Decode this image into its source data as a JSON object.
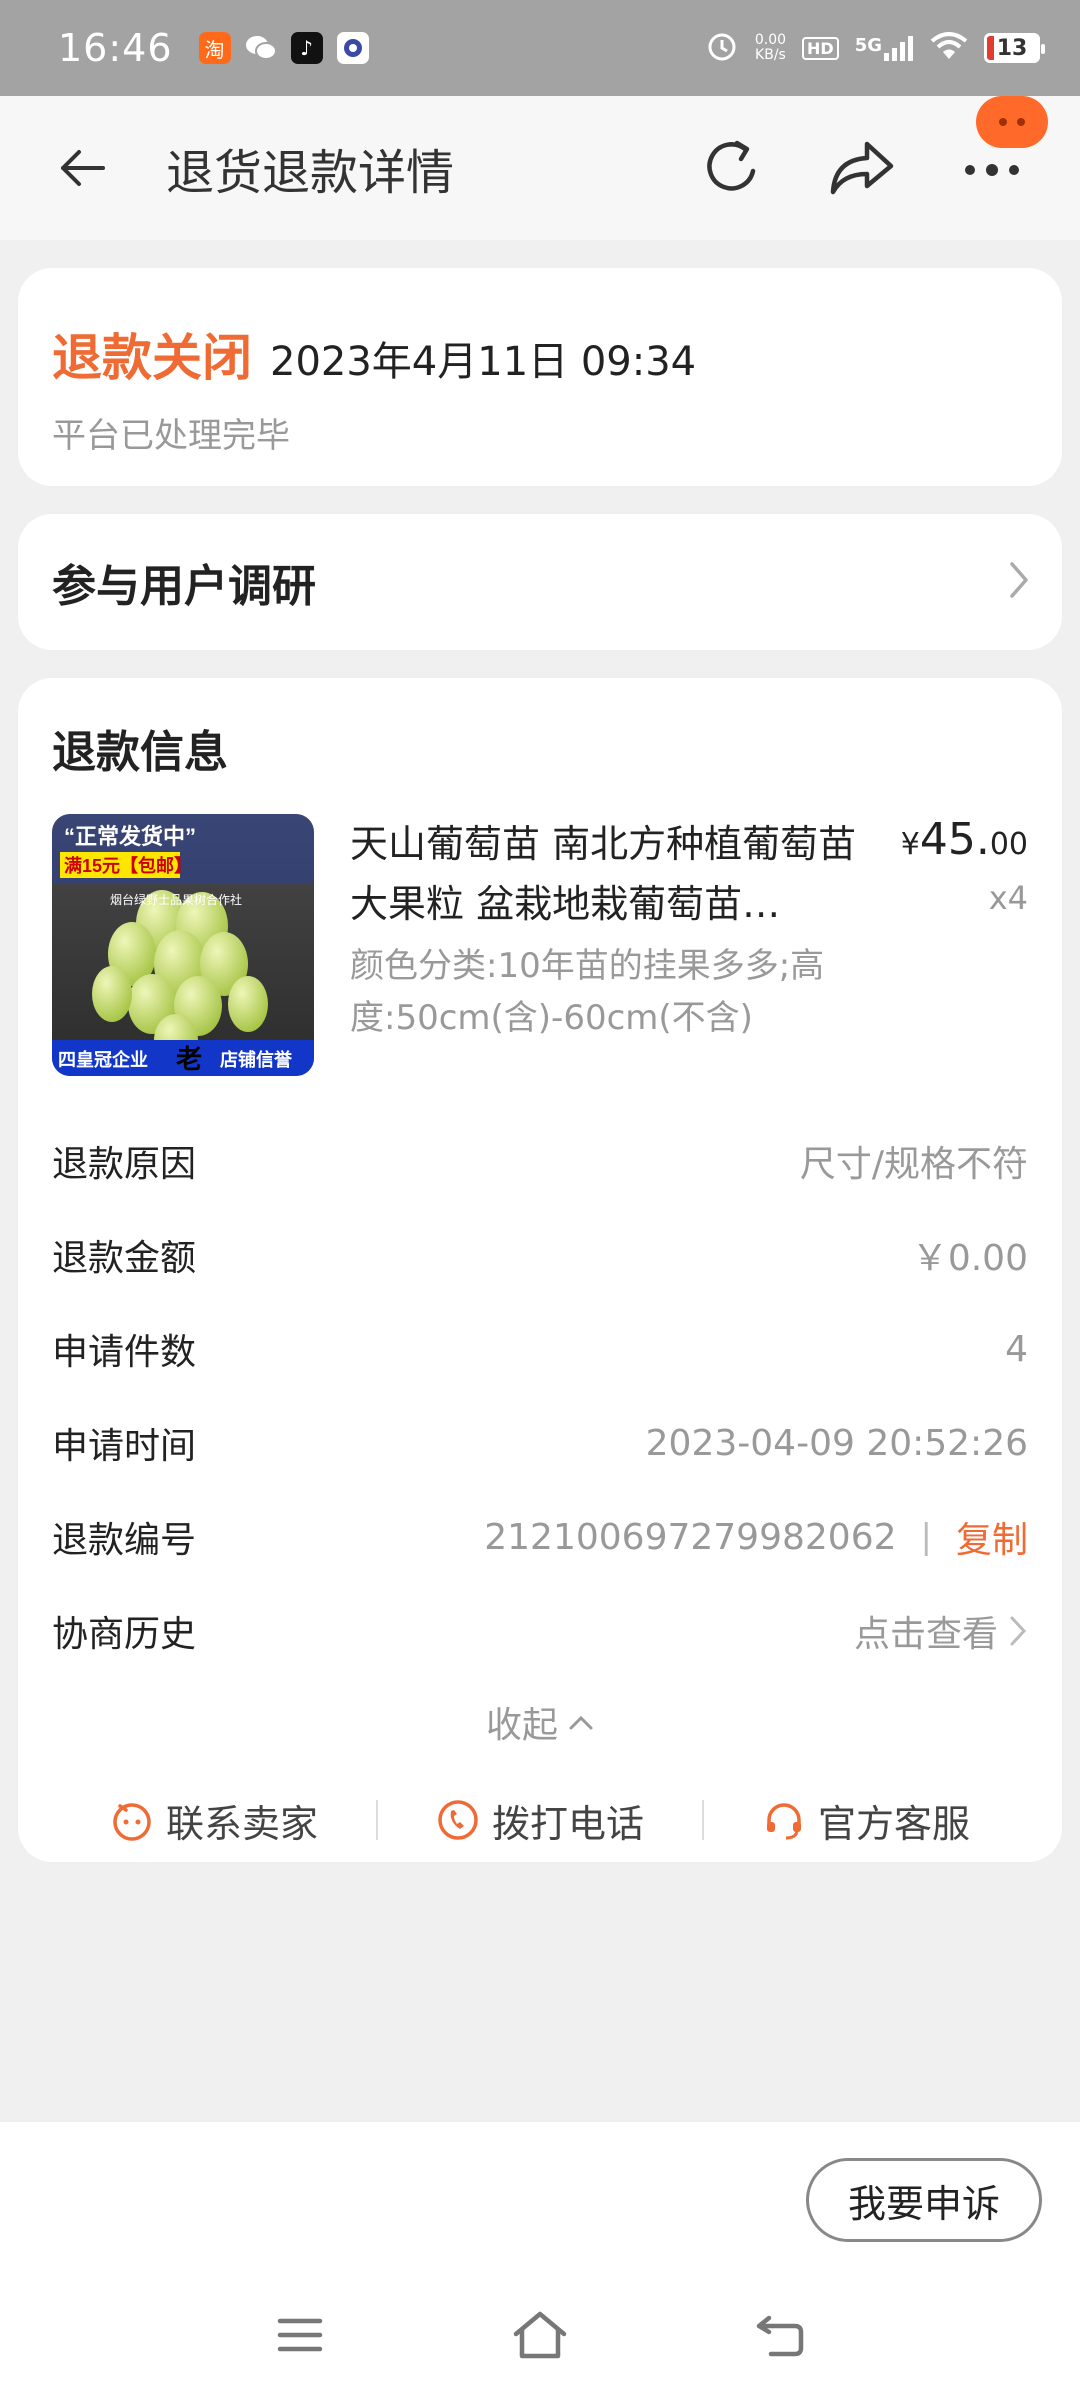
{
  "status_bar": {
    "time": "16:46",
    "net_speed": "0.00",
    "net_unit": "KB/s",
    "hd": "HD",
    "signal": "5G",
    "battery": "13"
  },
  "header": {
    "title": "退货退款详情"
  },
  "status_card": {
    "status": "退款关闭",
    "time": "2023年4月11日 09:34",
    "subtitle": "平台已处理完毕"
  },
  "survey": {
    "label": "参与用户调研"
  },
  "refund_info": {
    "title": "退款信息",
    "product": {
      "name": "天山葡萄苗 南北方种植葡萄苗 大果粒 盆栽地栽葡萄苗…",
      "spec": "颜色分类:10年苗的挂果多多;高度:50cm(含)-60cm(不含)",
      "price_currency": "¥",
      "price_int": "45.",
      "price_dec": "00",
      "quantity": "x4",
      "thumb_text_top": "“正常发货中”",
      "thumb_text_promo": "满15元【包邮】",
      "thumb_text_store": "烟台绿野士品果树合作社",
      "thumb_text_bottom_left": "四皇冠企业",
      "thumb_text_bottom_mid": "老",
      "thumb_text_bottom_right": "店铺信誉"
    },
    "rows": [
      {
        "label": "退款原因",
        "value": "尺寸/规格不符"
      },
      {
        "label": "退款金额",
        "value": "￥0.00"
      },
      {
        "label": "申请件数",
        "value": "4"
      },
      {
        "label": "申请时间",
        "value": "2023-04-09 20:52:26"
      },
      {
        "label": "退款编号",
        "value": "212100697279982062"
      },
      {
        "label": "协商历史",
        "value": "点击查看"
      }
    ],
    "copy_label": "复制",
    "copy_sep": "|",
    "collapse_label": "收起"
  },
  "contacts": [
    {
      "label": "联系卖家",
      "icon": "chat-bubble-icon"
    },
    {
      "label": "拨打电话",
      "icon": "phone-icon"
    },
    {
      "label": "官方客服",
      "icon": "headset-icon"
    }
  ],
  "appeal": {
    "label": "我要申诉"
  },
  "colors": {
    "accent": "#f06a34",
    "status_bar": "#a3a3a3",
    "page_bg": "#f0f0f0"
  }
}
